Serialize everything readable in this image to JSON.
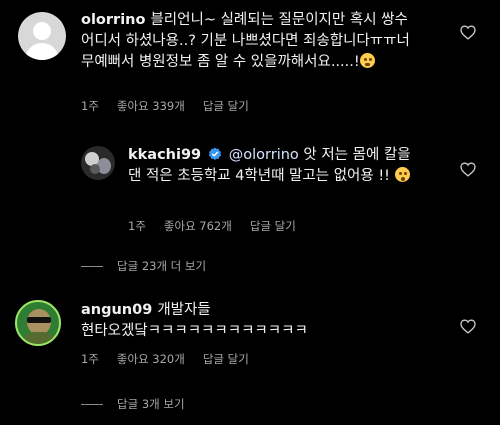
{
  "comments": [
    {
      "username": "olorrino",
      "body": "블리언니~ 실례되는 질문이지만 혹시 쌍수어디서 하셨나용..? 기분 나쁘셨다면 죄송합니다ㅠㅠ너무예뻐서 병원정보 좀 알 수 있을까해서요.....!",
      "time": "1주",
      "likes": "좋아요 339개",
      "reply": "답글 달기",
      "avatar_icon": "default-profile-icon",
      "emoji": "worried-face-emoji"
    },
    {
      "username": "kkachi99",
      "verified": true,
      "mention": "@olorrino",
      "body": "앗 저는 몸에 칼을 댄 적은 초등학교 4학년때 말고는 없어용 !!",
      "time": "1주",
      "likes": "좋아요 762개",
      "reply": "답글 달기",
      "avatar_icon": "cat-avatar-icon",
      "emoji": "surprised-face-emoji"
    },
    {
      "username": "angun09",
      "body_line1": "개발자들",
      "body_line2": "현타오겠닼ㅋㅋㅋㅋㅋㅋㅋㅋㅋㅋㅋㅋ",
      "time": "1주",
      "likes": "좋아요 320개",
      "reply": "답글 달기",
      "avatar_icon": "person-sunglasses-avatar-icon"
    }
  ],
  "view_replies": [
    {
      "label": "답글 23개 더 보기"
    },
    {
      "label": "답글 3개 보기"
    }
  ],
  "colors": {
    "background": "#000000",
    "verified_badge": "#3897f0",
    "mention": "#d6e4ff",
    "meta": "#a8a8a8"
  }
}
